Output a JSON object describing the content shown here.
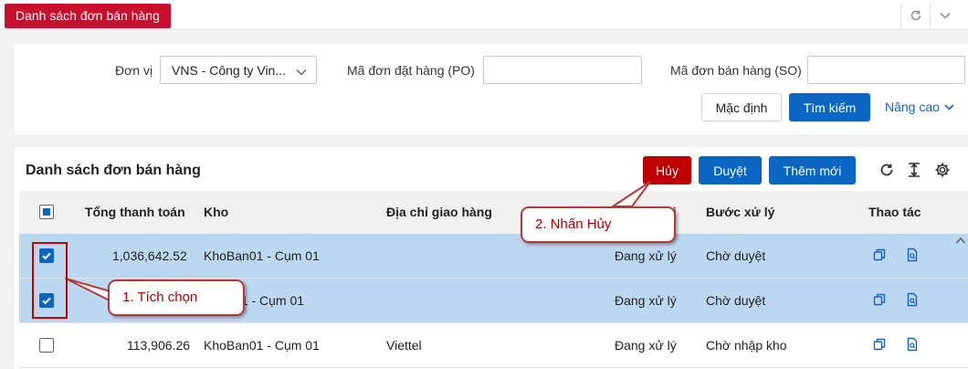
{
  "tab": {
    "title": "Danh sách đơn bán hàng"
  },
  "filters": {
    "unit_label": "Đơn vị",
    "unit_value": "VNS - Công ty Vin...",
    "po_label": "Mã đơn đặt hàng (PO)",
    "po_value": "",
    "so_label": "Mã đơn bán hàng (SO)",
    "so_value": "",
    "default_button": "Mặc định",
    "search_button": "Tìm kiếm",
    "advanced_link": "Nâng cao"
  },
  "list": {
    "title": "Danh sách đơn bán hàng",
    "cancel_button": "Hủy",
    "approve_button": "Duyệt",
    "add_button": "Thêm mới"
  },
  "table": {
    "columns": {
      "total": "Tổng thanh toán",
      "warehouse": "Kho",
      "address": "Địa chỉ giao hàng",
      "status": "ái",
      "step": "Bước xử lý",
      "actions": "Thao tác"
    },
    "rows": [
      {
        "total": "1,036,642.52",
        "warehouse": "KhoBan01 - Cụm 01",
        "address": "",
        "status": "Đang xử lý",
        "step": "Chờ duyệt",
        "checked": true
      },
      {
        "total": "",
        "warehouse": "01 - Cụm 01",
        "address": "",
        "status": "Đang xử lý",
        "step": "Chờ duyệt",
        "checked": true
      },
      {
        "total": "113,906.26",
        "warehouse": "KhoBan01 - Cụm 01",
        "address": "Viettel",
        "status": "Đang xử lý",
        "step": "Chờ nhập kho",
        "checked": false
      }
    ]
  },
  "annotations": {
    "step1": "1. Tích chọn",
    "step2": "2. Nhấn Hủy"
  },
  "colors": {
    "brand_red": "#c8102e",
    "primary_blue": "#0b66c3",
    "selected_row": "#bcd7f0",
    "annotation_red": "#c00000"
  }
}
